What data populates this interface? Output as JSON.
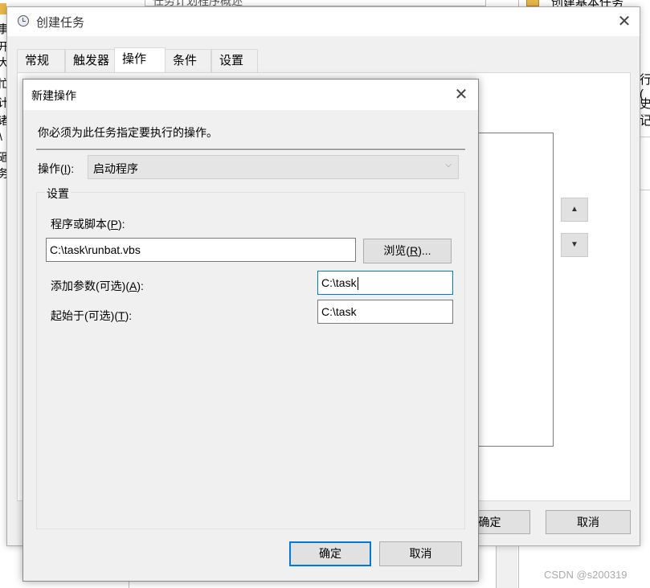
{
  "background": {
    "frag_top_left": "任务计划程序概述",
    "frag_top_right": "创建基本任务",
    "frag_right_1": "行(",
    "frag_right_2": "史记",
    "frag_left_chars": [
      "事",
      "开",
      "大",
      "忙",
      "计",
      "诸",
      "\\",
      "砸",
      "务"
    ]
  },
  "outer_dialog": {
    "title": "创建任务",
    "tabs": [
      "常规",
      "触发器",
      "操作",
      "条件",
      "设置"
    ],
    "active_tab": "操作",
    "move_up_label": "▲",
    "move_down_label": "▼",
    "ok_label": "确定",
    "cancel_label": "取消"
  },
  "new_action_dialog": {
    "title": "新建操作",
    "instruction": "你必须为此任务指定要执行的操作。",
    "action_label": "操作(",
    "action_label_key": "I",
    "action_label_end": "):",
    "action_value": "启动程序",
    "settings_legend": "设置",
    "program_label": "程序或脚本(",
    "program_label_key": "P",
    "program_label_end": "):",
    "program_value": "C:\\task\\runbat.vbs",
    "browse_label": "浏览(",
    "browse_key": "R",
    "browse_end": ")...",
    "args_label": "添加参数(可选)(",
    "args_key": "A",
    "args_end": "):",
    "args_value": "C:\\task",
    "start_in_label": "起始于(可选)(",
    "start_in_key": "T",
    "start_in_end": "):",
    "start_in_value": "C:\\task",
    "ok_label": "确定",
    "cancel_label": "取消"
  },
  "watermark": "CSDN @s200319",
  "colors": {
    "accent": "#0078d7",
    "dialog_bg": "#f0f0f0",
    "button_bg": "#e1e1e1"
  }
}
